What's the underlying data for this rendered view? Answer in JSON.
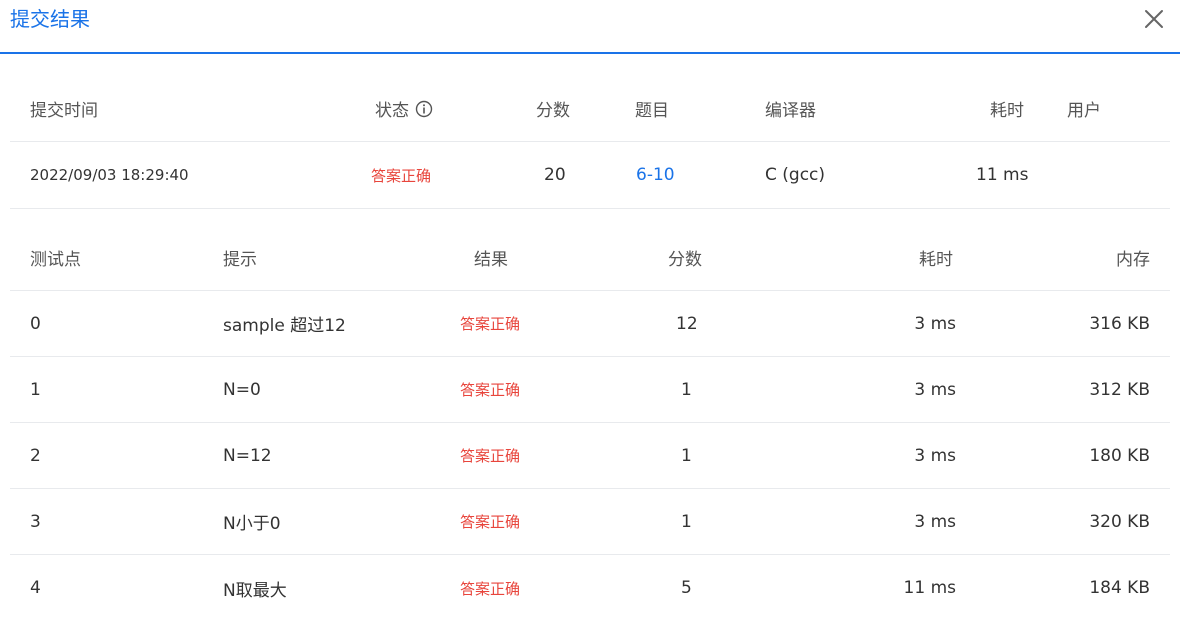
{
  "dialog": {
    "title": "提交结果",
    "close_icon": "close-icon"
  },
  "summary": {
    "headers": {
      "time": "提交时间",
      "status": "状态",
      "score": "分数",
      "problem": "题目",
      "compiler": "编译器",
      "elapsed": "耗时",
      "user": "用户"
    },
    "row": {
      "time": "2022/09/03 18:29:40",
      "status": "答案正确",
      "score": "20",
      "problem": "6-10",
      "compiler": "C (gcc)",
      "elapsed": "11 ms",
      "user": ""
    }
  },
  "tests": {
    "headers": {
      "case": "测试点",
      "hint": "提示",
      "result": "结果",
      "score": "分数",
      "elapsed": "耗时",
      "memory": "内存"
    },
    "rows": [
      {
        "case": "0",
        "hint": "sample 超过12",
        "result": "答案正确",
        "score": "12",
        "elapsed": "3 ms",
        "memory": "316 KB"
      },
      {
        "case": "1",
        "hint": "N=0",
        "result": "答案正确",
        "score": "1",
        "elapsed": "3 ms",
        "memory": "312 KB"
      },
      {
        "case": "2",
        "hint": "N=12",
        "result": "答案正确",
        "score": "1",
        "elapsed": "3 ms",
        "memory": "180 KB"
      },
      {
        "case": "3",
        "hint": "N小于0",
        "result": "答案正确",
        "score": "1",
        "elapsed": "3 ms",
        "memory": "320 KB"
      },
      {
        "case": "4",
        "hint": "N取最大",
        "result": "答案正确",
        "score": "5",
        "elapsed": "11 ms",
        "memory": "184 KB"
      }
    ]
  },
  "colors": {
    "accent": "#1a73e8",
    "success_text": "#e8453c",
    "divider": "#e8eaed"
  }
}
